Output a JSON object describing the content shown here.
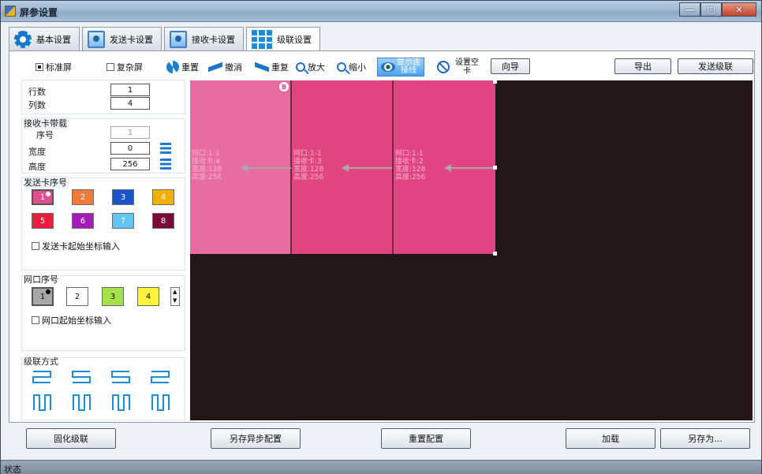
{
  "window": {
    "title": "屏参设置",
    "controls": [
      "—",
      "▢",
      "✕"
    ]
  },
  "tabs": [
    {
      "label": "基本设置",
      "icon": "gear-icon"
    },
    {
      "label": "发送卡设置",
      "icon": "card-icon"
    },
    {
      "label": "接收卡设置",
      "icon": "card-icon"
    },
    {
      "label": "级联设置",
      "icon": "grid-icon",
      "active": true
    }
  ],
  "toolbar": {
    "standard_screen": "标准屏",
    "complex_screen": "复杂屏",
    "reset": "重置",
    "undo": "撤消",
    "redo": "重复",
    "zoom_in": "放大",
    "zoom_out": "缩小",
    "show_lines": "显示连\n接线",
    "set_empty": "设置空\n卡",
    "wizard": "向导",
    "export": "导出",
    "send_cascade": "发送级联"
  },
  "grid": {
    "rows_label": "行数",
    "rows_value": "1",
    "cols_label": "列数",
    "cols_value": "4"
  },
  "receiver_load": {
    "title": "接收卡带载",
    "index_label": "序号",
    "index_value": "1",
    "width_label": "宽度",
    "width_value": "0",
    "height_label": "高度",
    "height_value": "256"
  },
  "sender_index": {
    "title": "发送卡序号",
    "items": [
      {
        "n": "1",
        "color": "#e0508e"
      },
      {
        "n": "2",
        "color": "#f07a3a"
      },
      {
        "n": "3",
        "color": "#1a54c8"
      },
      {
        "n": "4",
        "color": "#f2b000"
      },
      {
        "n": "5",
        "color": "#ec1b3a"
      },
      {
        "n": "6",
        "color": "#a61bb8"
      },
      {
        "n": "7",
        "color": "#62c6f4"
      },
      {
        "n": "8",
        "color": "#7a0a3a"
      }
    ],
    "coord_input": "发送卡起始坐标输入"
  },
  "port_index": {
    "title": "网口序号",
    "items": [
      {
        "n": "1",
        "color": "#a8a8a8"
      },
      {
        "n": "2",
        "color": "#ffffff"
      },
      {
        "n": "3",
        "color": "#a6e04a"
      },
      {
        "n": "4",
        "color": "#fff23a"
      }
    ],
    "coord_input": "网口起始坐标输入"
  },
  "cascade_mode": {
    "title": "级联方式"
  },
  "canvas": {
    "marker": "B",
    "cells": [
      {
        "lines": [
          "网口:1-1",
          "接收卡:4",
          "宽度:128",
          "高度:256"
        ],
        "color": "#e76ca2"
      },
      {
        "lines": [
          "网口:1-1",
          "接收卡:3",
          "宽度:128",
          "高度:256"
        ],
        "color": "#e14680"
      },
      {
        "lines": [
          "网口:1-1",
          "接收卡:2",
          "宽度:128",
          "高度:256"
        ],
        "color": "#e04482"
      }
    ]
  },
  "bottom_buttons": {
    "solidify": "固化级联",
    "save_async": "另存异步配置",
    "reset_config": "重置配置",
    "load": "加载",
    "save_as": "另存为..."
  },
  "status": {
    "text": "状态"
  },
  "colors": {
    "accent": "#1a8cd8",
    "canvas_bg": "#221616"
  }
}
